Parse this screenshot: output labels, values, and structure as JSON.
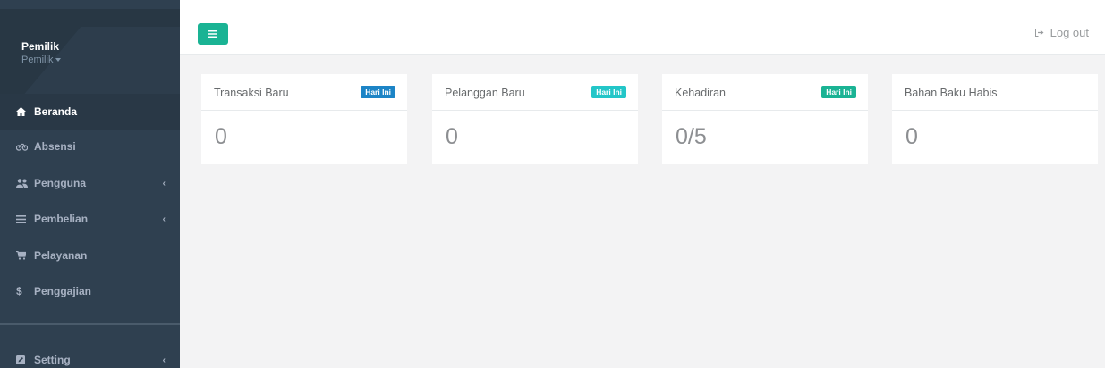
{
  "sidebar": {
    "profile": {
      "name": "Pemilik",
      "role": "Pemilik"
    },
    "items": [
      {
        "label": "Beranda",
        "icon": "home-icon",
        "active": true
      },
      {
        "label": "Absensi",
        "icon": "tachometer-icon"
      },
      {
        "label": "Pengguna",
        "icon": "users-icon",
        "arrow": "‹"
      },
      {
        "label": "Pembelian",
        "icon": "list-icon",
        "arrow": "‹"
      },
      {
        "label": "Pelayanan",
        "icon": "cart-icon"
      },
      {
        "label": "Penggajian",
        "icon": "dollar-icon"
      },
      {
        "label": "Setting",
        "icon": "edit-icon",
        "arrow": "‹"
      }
    ]
  },
  "topbar": {
    "logout_label": "Log out"
  },
  "widgets": [
    {
      "title": "Transaksi Baru",
      "badge": "Hari Ini",
      "badge_color": "#1c84c6",
      "value": "0"
    },
    {
      "title": "Pelanggan Baru",
      "badge": "Hari Ini",
      "badge_color": "#23c6c8",
      "value": "0"
    },
    {
      "title": "Kehadiran",
      "badge": "Hari Ini",
      "badge_color": "#1ab394",
      "value": "0/5"
    },
    {
      "title": "Bahan Baku Habis",
      "value": "0"
    }
  ],
  "colors": {
    "sidebar": "#2f4050",
    "accent": "#1ab394"
  }
}
